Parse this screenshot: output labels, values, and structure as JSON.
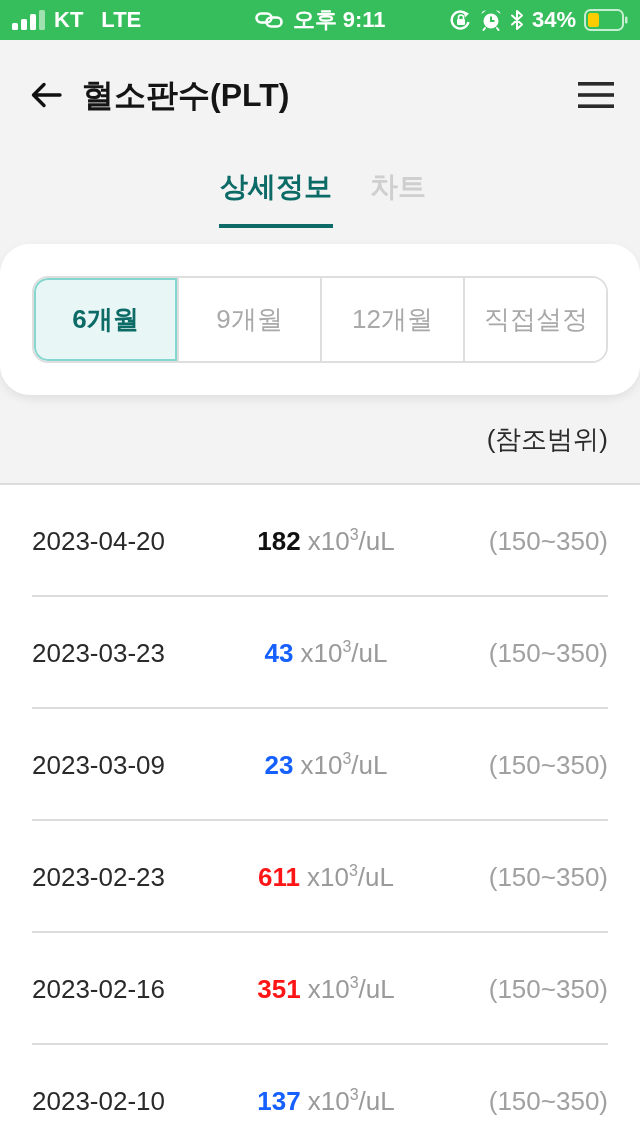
{
  "status_bar": {
    "carrier": "KT",
    "network": "LTE",
    "time": "오후 9:11",
    "battery": "34%"
  },
  "header": {
    "title": "혈소판수(PLT)"
  },
  "tabs": [
    {
      "label": "상세정보",
      "selected": true
    },
    {
      "label": "차트",
      "selected": false
    }
  ],
  "periods": [
    {
      "label": "6개월",
      "selected": true
    },
    {
      "label": "9개월",
      "selected": false
    },
    {
      "label": "12개월",
      "selected": false
    },
    {
      "label": "직접설정",
      "selected": false
    }
  ],
  "reference_label": "(참조범위)",
  "results": [
    {
      "date": "2023-04-20",
      "value": "182",
      "color": "#111111",
      "unit": "x10$^{3}$/uL",
      "range": "(150~350)"
    },
    {
      "date": "2023-03-23",
      "value": "43",
      "color": "#1560ff",
      "unit": "x10$^{3}$/uL",
      "range": "(150~350)"
    },
    {
      "date": "2023-03-09",
      "value": "23",
      "color": "#1560ff",
      "unit": "x10$^{3}$/uL",
      "range": "(150~350)"
    },
    {
      "date": "2023-02-23",
      "value": "611",
      "color": "#ff1515",
      "unit": "x10$^{3}$/uL",
      "range": "(150~350)"
    },
    {
      "date": "2023-02-16",
      "value": "351",
      "color": "#ff1515",
      "unit": "x10$^{3}$/uL",
      "range": "(150~350)"
    },
    {
      "date": "2023-02-10",
      "value": "137",
      "color": "#1560ff",
      "unit": "x10$^{3}$/uL",
      "range": "(150~350)"
    }
  ]
}
